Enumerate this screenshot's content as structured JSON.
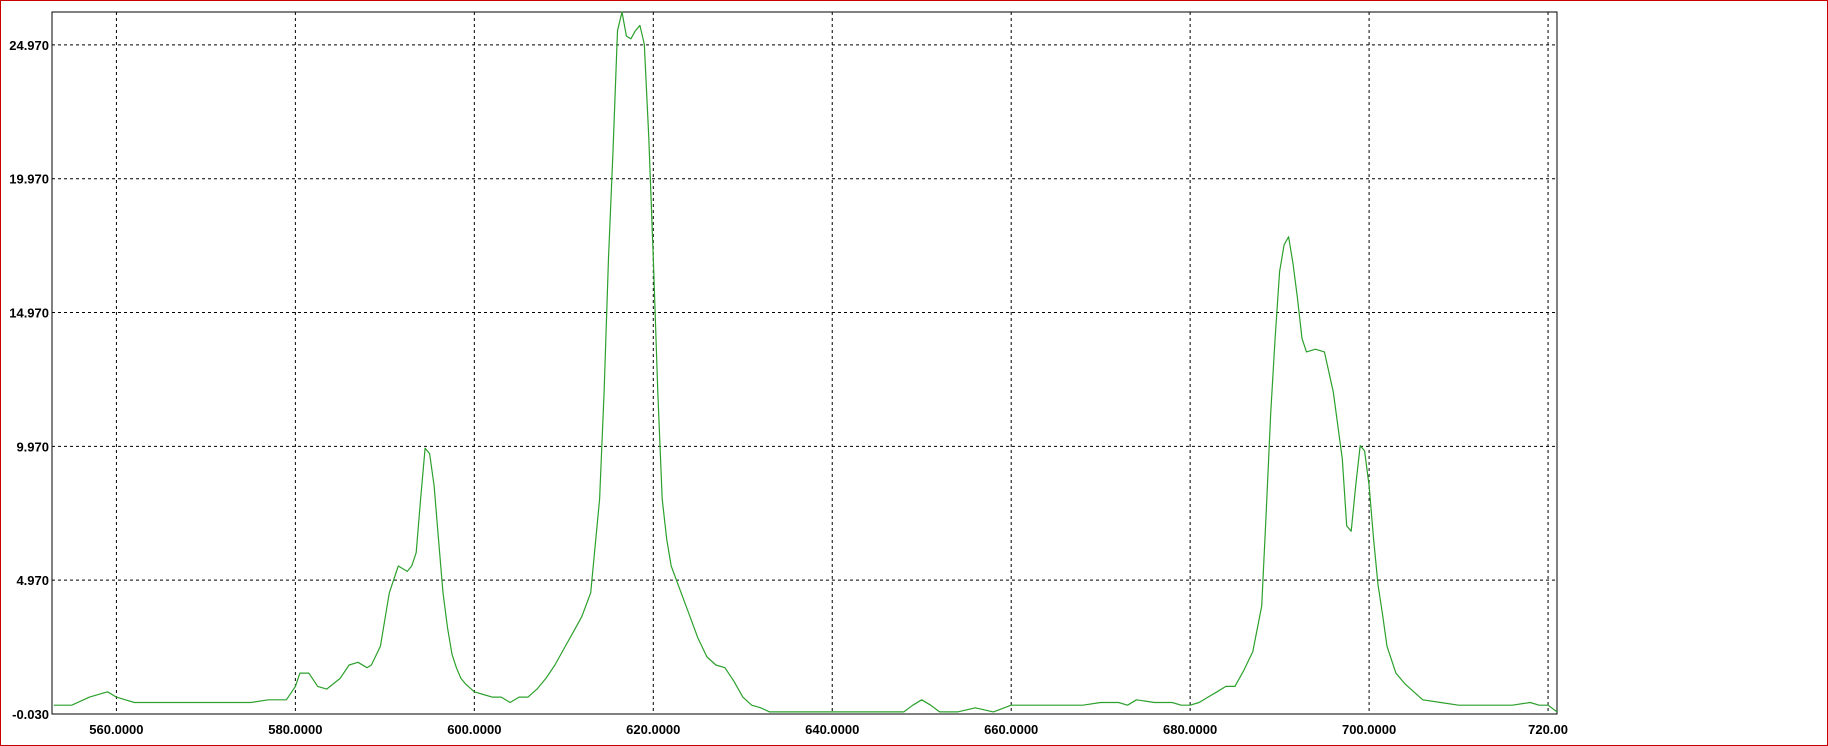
{
  "colors": {
    "frame": "#c80000",
    "series": "#2ca02c",
    "grid": "#000000",
    "background": "#ffffff"
  },
  "chart_data": {
    "type": "line",
    "title": "",
    "xlabel": "",
    "ylabel": "",
    "xlim": [
      552.8,
      721.0
    ],
    "ylim": [
      -0.03,
      26.2
    ],
    "grid": true,
    "legend": "none",
    "x_ticks": [
      560,
      580,
      600,
      620,
      640,
      660,
      680,
      700,
      720
    ],
    "x_tick_labels": [
      "560.0000",
      "580.0000",
      "600.0000",
      "620.0000",
      "640.0000",
      "660.0000",
      "680.0000",
      "700.0000",
      "720.00"
    ],
    "y_ticks": [
      -0.03,
      4.97,
      9.97,
      14.97,
      19.97,
      24.97
    ],
    "y_tick_labels": [
      "-0.030",
      "4.970",
      "9.970",
      "14.970",
      "19.970",
      "24.970"
    ],
    "series": [
      {
        "color": "#2ca02c",
        "x": [
          553,
          555,
          557,
          559,
          560,
          562,
          565,
          567,
          570,
          572,
          575,
          577,
          578,
          579,
          580,
          580.5,
          581.5,
          582.5,
          583.5,
          585,
          586,
          587,
          588,
          588.5,
          589.5,
          590.5,
          591.5,
          592.5,
          593,
          593.5,
          594,
          594.5,
          595,
          595.5,
          596,
          596.5,
          597,
          597.5,
          598,
          598.5,
          599,
          600,
          601,
          602,
          603,
          604,
          605,
          606,
          607,
          608,
          609,
          610,
          611,
          612,
          613,
          614,
          614.5,
          615,
          615.5,
          616,
          616.5,
          617,
          617.5,
          618,
          618.5,
          619,
          619.5,
          620,
          620.5,
          621,
          621.5,
          622,
          623,
          624,
          625,
          626,
          627,
          628,
          629,
          630,
          631,
          632,
          633,
          635,
          640,
          645,
          648,
          649,
          650,
          651,
          652,
          654,
          656,
          658,
          660,
          662,
          664,
          666,
          668,
          670,
          672,
          673,
          674,
          676,
          678,
          679,
          680,
          681,
          682,
          683,
          684,
          685,
          686,
          687,
          688,
          688.5,
          689,
          689.5,
          690,
          690.5,
          691,
          691.5,
          692,
          692.5,
          693,
          694,
          695,
          696,
          697,
          697.5,
          698,
          698.5,
          699,
          699.5,
          700,
          700.5,
          701,
          701.5,
          702,
          703,
          704,
          705,
          706,
          708,
          710,
          712,
          714,
          716,
          718,
          719,
          720,
          721
        ],
        "y": [
          0.3,
          0.3,
          0.6,
          0.8,
          0.6,
          0.4,
          0.4,
          0.4,
          0.4,
          0.4,
          0.4,
          0.5,
          0.5,
          0.5,
          1.0,
          1.5,
          1.5,
          1.0,
          0.9,
          1.3,
          1.8,
          1.9,
          1.7,
          1.8,
          2.5,
          4.5,
          5.5,
          5.3,
          5.5,
          6.0,
          8.0,
          9.9,
          9.7,
          8.5,
          6.5,
          4.5,
          3.2,
          2.2,
          1.7,
          1.3,
          1.1,
          0.8,
          0.7,
          0.6,
          0.6,
          0.4,
          0.6,
          0.6,
          0.9,
          1.3,
          1.8,
          2.4,
          3.0,
          3.6,
          4.5,
          8.0,
          12.0,
          17.0,
          21.0,
          25.5,
          26.2,
          25.3,
          25.2,
          25.5,
          25.7,
          25.0,
          21.5,
          17.0,
          12.0,
          8.0,
          6.5,
          5.5,
          4.6,
          3.7,
          2.8,
          2.1,
          1.8,
          1.7,
          1.2,
          0.6,
          0.3,
          0.2,
          0.05,
          0.05,
          0.05,
          0.05,
          0.05,
          0.3,
          0.5,
          0.3,
          0.05,
          0.05,
          0.2,
          0.05,
          0.3,
          0.3,
          0.3,
          0.3,
          0.3,
          0.4,
          0.4,
          0.3,
          0.5,
          0.4,
          0.4,
          0.3,
          0.3,
          0.4,
          0.6,
          0.8,
          1.0,
          1.0,
          1.6,
          2.3,
          4.0,
          7.5,
          11.2,
          14.0,
          16.5,
          17.5,
          17.8,
          16.8,
          15.5,
          14.0,
          13.5,
          13.6,
          13.5,
          12.0,
          9.5,
          7.0,
          6.8,
          8.5,
          10.0,
          9.8,
          8.5,
          6.5,
          4.8,
          3.7,
          2.5,
          1.5,
          1.1,
          0.8,
          0.5,
          0.4,
          0.3,
          0.3,
          0.3,
          0.3,
          0.4,
          0.3,
          0.3,
          0.05
        ]
      }
    ]
  }
}
